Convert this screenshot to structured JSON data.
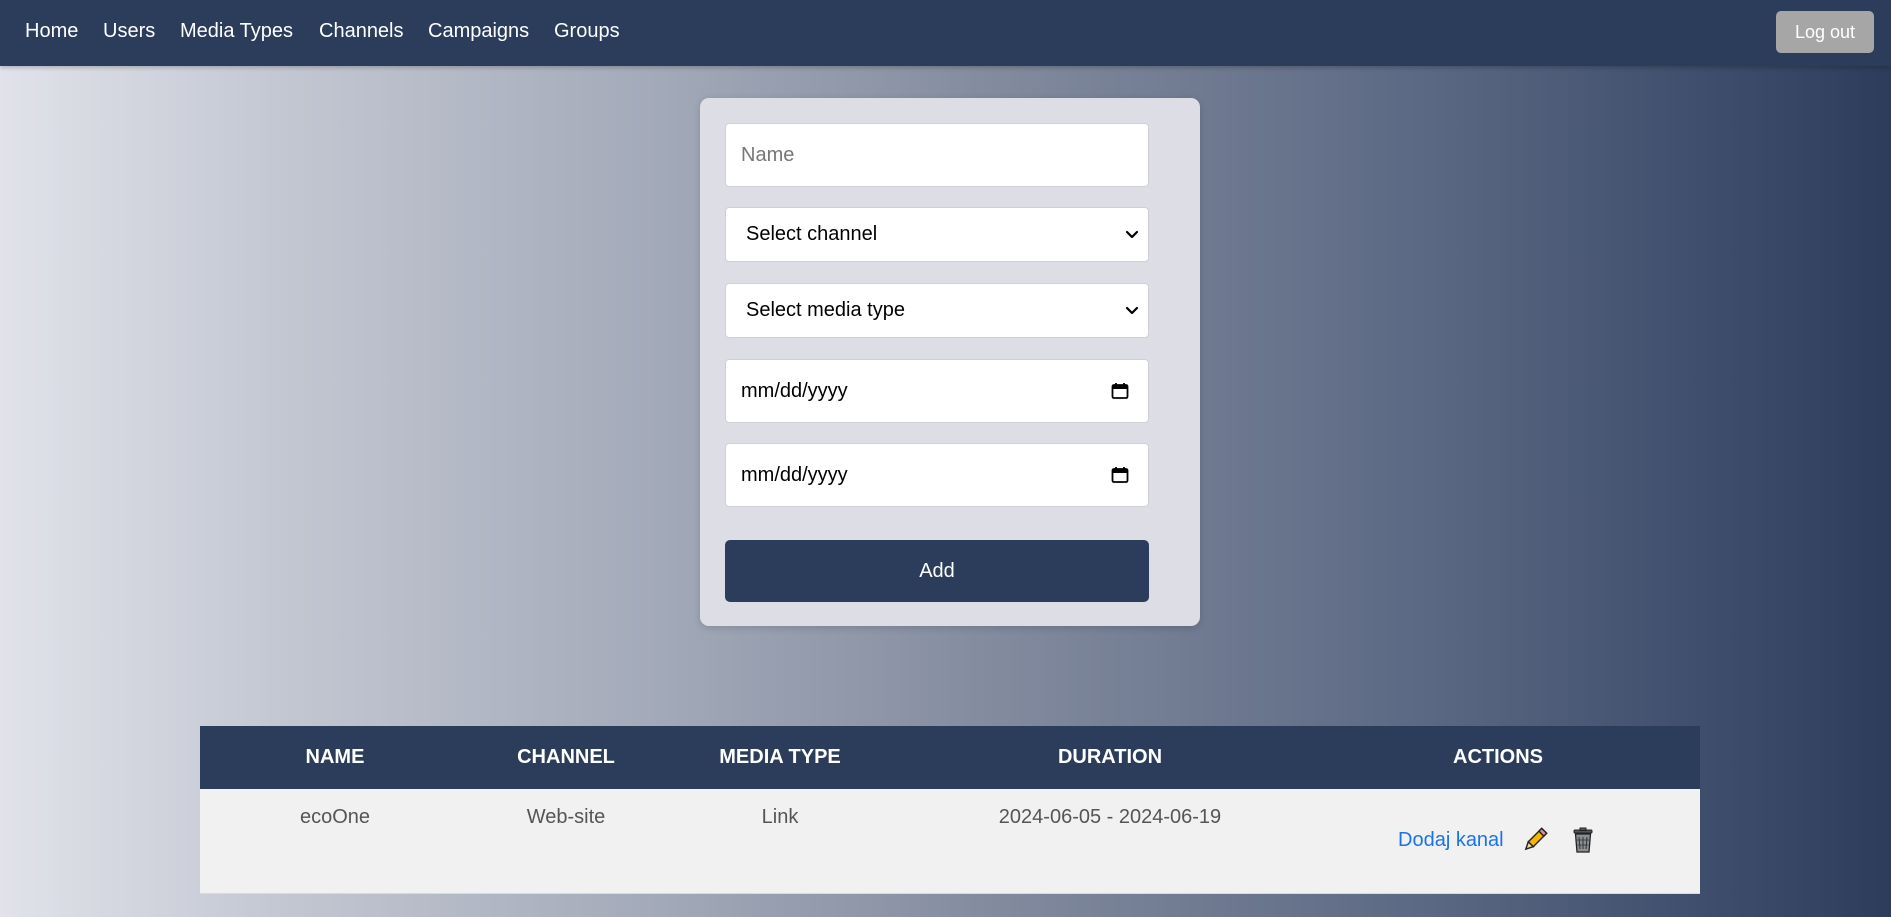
{
  "nav": {
    "items": [
      {
        "label": "Home"
      },
      {
        "label": "Users"
      },
      {
        "label": "Media Types"
      },
      {
        "label": "Channels"
      },
      {
        "label": "Campaigns"
      },
      {
        "label": "Groups"
      }
    ],
    "logout_label": "Log out"
  },
  "form": {
    "name_placeholder": "Name",
    "channel_select": "Select channel",
    "media_type_select": "Select media type",
    "start_date_placeholder": "mm/dd/yyyy",
    "end_date_placeholder": "mm/dd/yyyy",
    "add_label": "Add"
  },
  "table": {
    "headers": [
      "NAME",
      "CHANNEL",
      "MEDIA TYPE",
      "DURATION",
      "ACTIONS"
    ],
    "rows": [
      {
        "name": "ecoOne",
        "channel": "Web-site",
        "media_type": "Link",
        "duration": "2024-06-05 - 2024-06-19",
        "action_link": "Dodaj kanal",
        "edit_icon": "pencil-icon",
        "delete_icon": "trash-icon"
      }
    ]
  },
  "colors": {
    "navbar": "#2c3d5b",
    "primary_button": "#2c3d5b",
    "logout_button": "#a6a6a6",
    "link": "#1a73e8"
  }
}
